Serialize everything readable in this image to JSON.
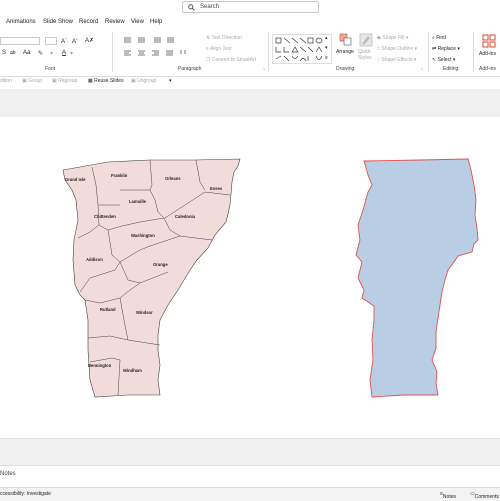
{
  "search": {
    "placeholder": "Search"
  },
  "menu": [
    "Animations",
    "Slide Show",
    "Record",
    "Review",
    "View",
    "Help"
  ],
  "ribbon": {
    "groups": {
      "font": "Font",
      "paragraph": "Paragraph",
      "drawing": "Drawing",
      "editing": "Editing",
      "addins": "Add-ins"
    },
    "paragraph": {
      "text_direction": "Text Direction",
      "align_text": "Align Text",
      "convert_smartart": "Convert to SmartArt"
    },
    "drawing": {
      "arrange": "Arrange",
      "quick_styles": "Quick Styles",
      "shape_fill": "Shape Fill",
      "shape_outline": "Shape Outline",
      "shape_effects": "Shape Effects"
    },
    "editing": {
      "find": "Find",
      "replace": "Replace",
      "select": "Select"
    },
    "addins": "Add-ins"
  },
  "qat": {
    "edit": "dition",
    "group": "Group",
    "regroup": "Regroup",
    "reuse": "Reuse Slides",
    "ungroup": "Ungroup"
  },
  "counties": [
    "Grand Isle",
    "Franklin",
    "Orleans",
    "Essex",
    "Lamoille",
    "Chittenden",
    "Caledonia",
    "Washington",
    "Addison",
    "Orange",
    "Rutland",
    "Windsor",
    "Bennington",
    "Windham"
  ],
  "notes": {
    "label": "Notes"
  },
  "status": {
    "left": "ccessibility: Investigate",
    "notes": "Notes",
    "comments": "Comments"
  },
  "colors": {
    "county_fill": "#f2dcdb",
    "state_fill": "#b9cde5",
    "state_outline": "#e0524f"
  }
}
